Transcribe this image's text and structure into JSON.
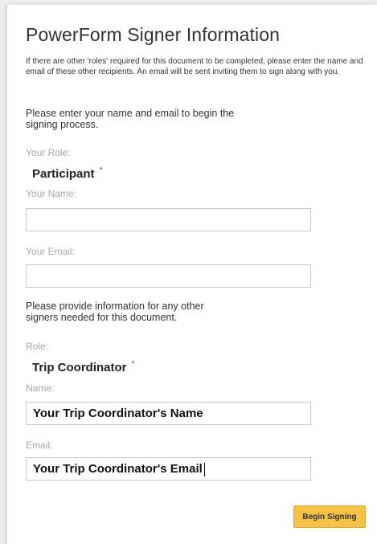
{
  "title": "PowerForm Signer Information",
  "intro": "If there are other 'roles' required for this document to be completed, please enter the name and email of these other recipients. An email will be sent inviting them to sign along with you.",
  "signer_prompt": "Please enter your name and email to begin the signing process.",
  "signer": {
    "role_label": "Your Role:",
    "role": "Participant",
    "required_mark": "*",
    "name_label": "Your Name:",
    "name_value": "",
    "email_label": "Your Email:",
    "email_value": ""
  },
  "others_prompt": "Please provide information for any other signers needed for this document.",
  "other": {
    "role_label": "Role:",
    "role": "Trip Coordinator",
    "required_mark": "*",
    "name_label": "Name:",
    "name_value": "Your Trip Coordinator's Name",
    "email_label": "Email:",
    "email_value": "Your Trip Coordinator's Email"
  },
  "submit_label": "Begin Signing",
  "colors": {
    "button": "#f6c246",
    "required": "#d23a2d",
    "label": "#a8a8a8"
  }
}
